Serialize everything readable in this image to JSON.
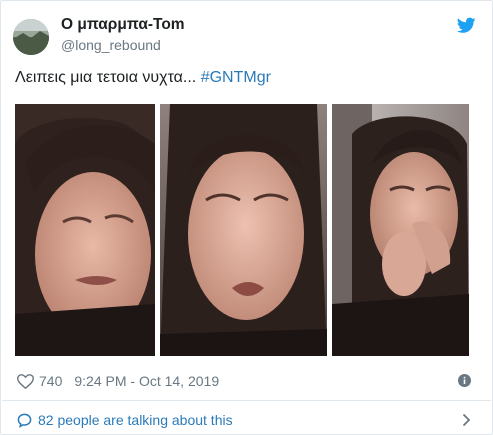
{
  "author": {
    "display_name": "Ο μπαρμπα-Tom",
    "handle": "@long_rebound",
    "avatar_icon": "profile-avatar"
  },
  "tweet": {
    "text": "Λειπεις μια τετοια νυχτα... ",
    "hashtag": "#GNTMgr"
  },
  "media": {
    "photos": [
      "photo-crying-woman-1",
      "photo-crying-woman-2",
      "photo-crying-woman-3"
    ]
  },
  "stats": {
    "likes": "740",
    "timestamp": "9:24 PM - Oct 14, 2019"
  },
  "conversation": {
    "label": "82 people are talking about this"
  },
  "colors": {
    "link": "#2b7bb9",
    "muted": "#697882",
    "twitter_blue": "#1da1f2",
    "border": "#e1e8ed"
  }
}
